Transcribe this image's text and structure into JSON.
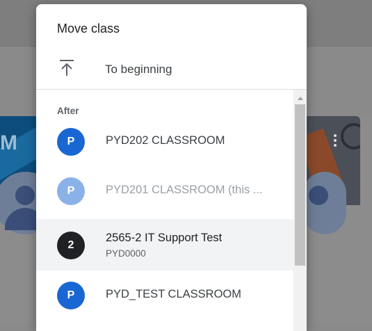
{
  "dialog": {
    "title": "Move class",
    "to_beginning_label": "To beginning",
    "section_label": "After"
  },
  "classes": [
    {
      "badge": "P",
      "name": "PYD202 CLASSROOM",
      "sub": "",
      "badge_color": "#1967d2",
      "state": "normal"
    },
    {
      "badge": "P",
      "name": "PYD201 CLASSROOM (this ...",
      "sub": "",
      "badge_color": "#1967d2",
      "state": "disabled"
    },
    {
      "badge": "2",
      "name": "2565-2 IT Support Test",
      "sub": "PYD0000",
      "badge_color": "#202124",
      "state": "selected"
    },
    {
      "badge": "P",
      "name": "PYD_TEST CLASSROOM",
      "sub": "",
      "badge_color": "#1967d2",
      "state": "normal"
    }
  ],
  "background": {
    "left_card_letter": "M"
  },
  "icons": {
    "to_beginning": "vertical-align-top-icon",
    "scroll_up": "scroll-up-arrow-icon",
    "more": "more-vert-icon"
  }
}
